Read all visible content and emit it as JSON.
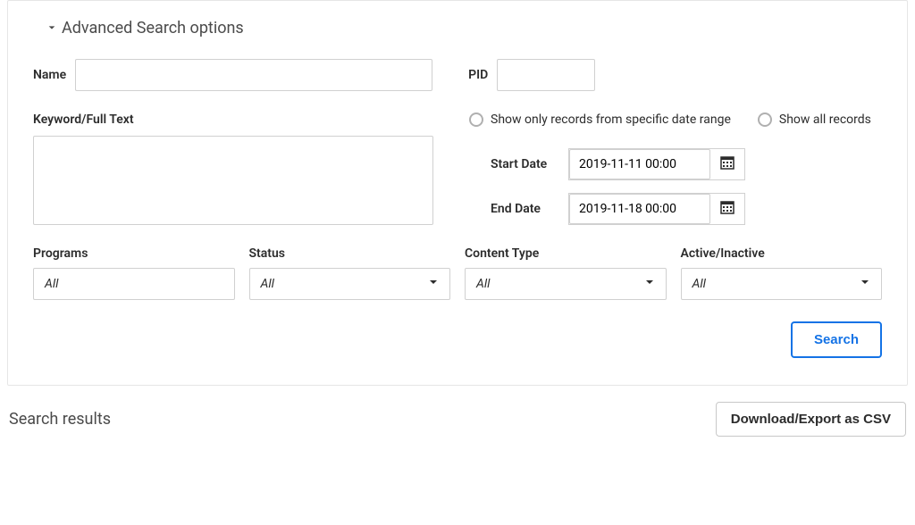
{
  "header": {
    "title": "Advanced Search options"
  },
  "fields": {
    "name_label": "Name",
    "name_value": "",
    "pid_label": "PID",
    "pid_value": "",
    "keyword_label": "Keyword/Full Text",
    "keyword_value": ""
  },
  "dateFilter": {
    "radio_specific": "Show only records from specific date range",
    "radio_all": "Show all records",
    "start_label": "Start Date",
    "start_value": "2019-11-11 00:00",
    "end_label": "End Date",
    "end_value": "2019-11-18 00:00"
  },
  "filters": {
    "programs": {
      "label": "Programs",
      "value": "All"
    },
    "status": {
      "label": "Status",
      "value": "All"
    },
    "content_type": {
      "label": "Content Type",
      "value": "All"
    },
    "active": {
      "label": "Active/Inactive",
      "value": "All"
    }
  },
  "actions": {
    "search": "Search",
    "export": "Download/Export as CSV"
  },
  "results": {
    "title": "Search results"
  }
}
